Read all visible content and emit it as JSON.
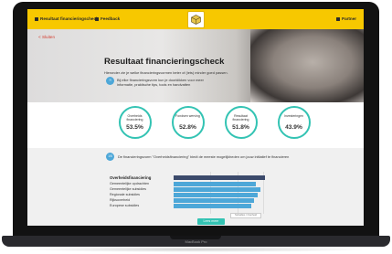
{
  "device": {
    "label": "MacBook Pro"
  },
  "nav": {
    "left_item": "Resultaat financieringscheck",
    "feedback": "Feedback",
    "right_item": "Partner"
  },
  "page": {
    "back_link": "< Sluiten",
    "title": "Resultaat financieringscheck",
    "subtitle": "Hieronder zie je welke financieringsvormen beter of (iets) minder goed passen.",
    "note_badge": "?!",
    "note_text": "Bij elke financieringsvorm kun je doorklikken voor meer informatie, praktische tips, tools en handvatten"
  },
  "results": [
    {
      "label": "Overheids financiering",
      "value": "53.5%"
    },
    {
      "label": "Fondsen werving",
      "value": "52.8%"
    },
    {
      "label": "Resultaat financiering",
      "value": "51.8%"
    },
    {
      "label": "Investeringen",
      "value": "43.9%"
    }
  ],
  "question": {
    "badge": "1/5",
    "text": "De financieringsvorm \"Overheidsfinanciering\" biedt de meeste mogelijkheden om jouw initiatief te financieren"
  },
  "breakdown": {
    "heading": "Overheidsfinanciering",
    "items": [
      {
        "label": "Gemeentelijke opdrachten",
        "value": 0.9
      },
      {
        "label": "Gemeentelijke subsidies",
        "value": 0.95
      },
      {
        "label": "Regionale subsidies",
        "value": 0.92
      },
      {
        "label": "Rijksoverheid",
        "value": 0.88
      },
      {
        "label": "Europese subsidies",
        "value": 0.85
      }
    ],
    "heading_value": 1.0,
    "legend": "Subsidies / Overheid",
    "cta": "Lees meer"
  },
  "colors": {
    "accent": "#f7c800",
    "ring": "#33c3b3",
    "bar": "#4da7d8"
  }
}
